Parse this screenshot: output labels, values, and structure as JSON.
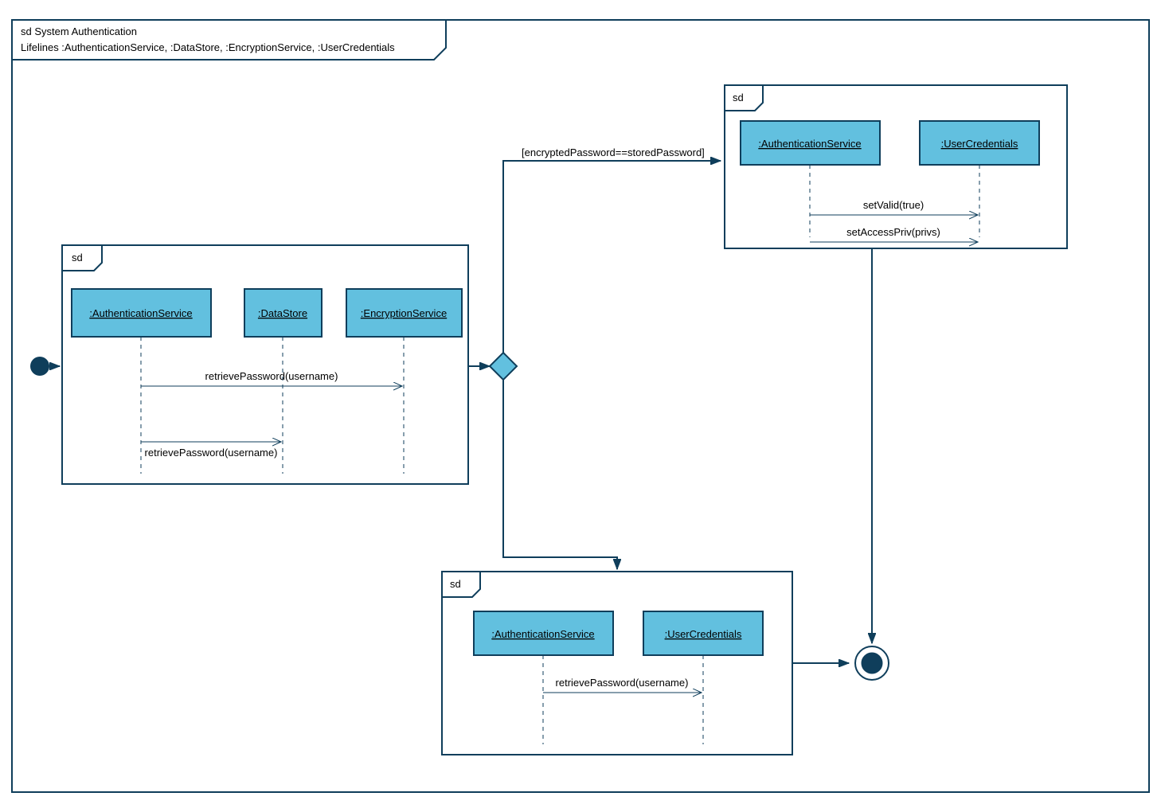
{
  "outer": {
    "tag": "sd",
    "title": "System Authentication",
    "lifelinesLabel": "Lifelines :AuthenticationService, :DataStore, :EncryptionService, :UserCredentials"
  },
  "frameA": {
    "tag": "sd",
    "lifelines": {
      "auth": ":AuthenticationService",
      "ds": ":DataStore",
      "enc": ":EncryptionService"
    },
    "msg1": "retrievePassword(username)",
    "msg2": "retrievePassword(username)"
  },
  "guard": "[encryptedPassword==storedPassword]",
  "frameB": {
    "tag": "sd",
    "lifelines": {
      "auth": ":AuthenticationService",
      "uc": ":UserCredentials"
    },
    "msg1": "setValid(true)",
    "msg2": "setAccessPriv(privs)"
  },
  "frameC": {
    "tag": "sd",
    "lifelines": {
      "auth": ":AuthenticationService",
      "uc": ":UserCredentials"
    },
    "msg1": "retrievePassword(username)"
  }
}
